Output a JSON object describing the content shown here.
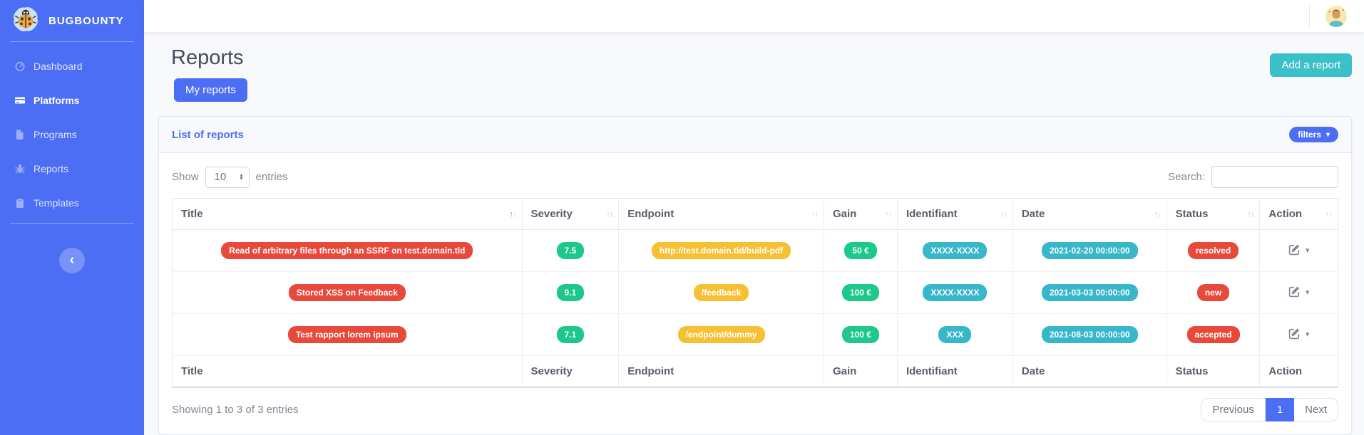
{
  "colors": {
    "primary": "#4c6ef5",
    "teal": "#3ac0c9",
    "danger": "#e74a3b",
    "success": "#1cc88a",
    "warning": "#f5c033",
    "info": "#38b6ca"
  },
  "sidebar": {
    "brand": "BUGBOUNTY",
    "items": [
      {
        "label": "Dashboard",
        "icon": "tachometer-icon",
        "active": false
      },
      {
        "label": "Platforms",
        "icon": "card-icon",
        "active": true
      },
      {
        "label": "Programs",
        "icon": "file-icon",
        "active": false
      },
      {
        "label": "Reports",
        "icon": "bug-icon",
        "active": false
      },
      {
        "label": "Templates",
        "icon": "clipboard-icon",
        "active": false
      }
    ]
  },
  "page": {
    "title": "Reports",
    "my_reports_button": "My reports",
    "add_report_button": "Add a report"
  },
  "card": {
    "title": "List of reports",
    "filters_button": "filters"
  },
  "table_controls": {
    "show_label": "Show",
    "page_length": "10",
    "entries_label": "entries",
    "search_label": "Search:",
    "search_value": ""
  },
  "table": {
    "columns": [
      "Title",
      "Severity",
      "Endpoint",
      "Gain",
      "Identifiant",
      "Date",
      "Status",
      "Action"
    ],
    "rows": [
      {
        "title": "Read of arbitrary files through an SSRF on test.domain.tld",
        "severity": "7.5",
        "endpoint": "http://test.domain.tld/build-pdf",
        "gain": "50 €",
        "identifiant": "XXXX-XXXX",
        "date": "2021-02-20 00:00:00",
        "status": "resolved"
      },
      {
        "title": "Stored XSS on Feedback",
        "severity": "9.1",
        "endpoint": "/feedback",
        "gain": "100 €",
        "identifiant": "XXXX-XXXX",
        "date": "2021-03-03 00:00:00",
        "status": "new"
      },
      {
        "title": "Test rapport lorem ipsum",
        "severity": "7.1",
        "endpoint": "/endpoint/dummy",
        "gain": "100 €",
        "identifiant": "XXX",
        "date": "2021-08-03 00:00:00",
        "status": "accepted"
      }
    ]
  },
  "footer": {
    "showing_text": "Showing 1 to 3 of 3 entries",
    "pagination": {
      "previous": "Previous",
      "page": "1",
      "next": "Next"
    }
  },
  "icons": {
    "sort_asc": "↑",
    "sort_desc": "↓",
    "caret_down": "▾",
    "collapse_chevron": "‹",
    "select_up": "▴",
    "select_down": "▾"
  }
}
